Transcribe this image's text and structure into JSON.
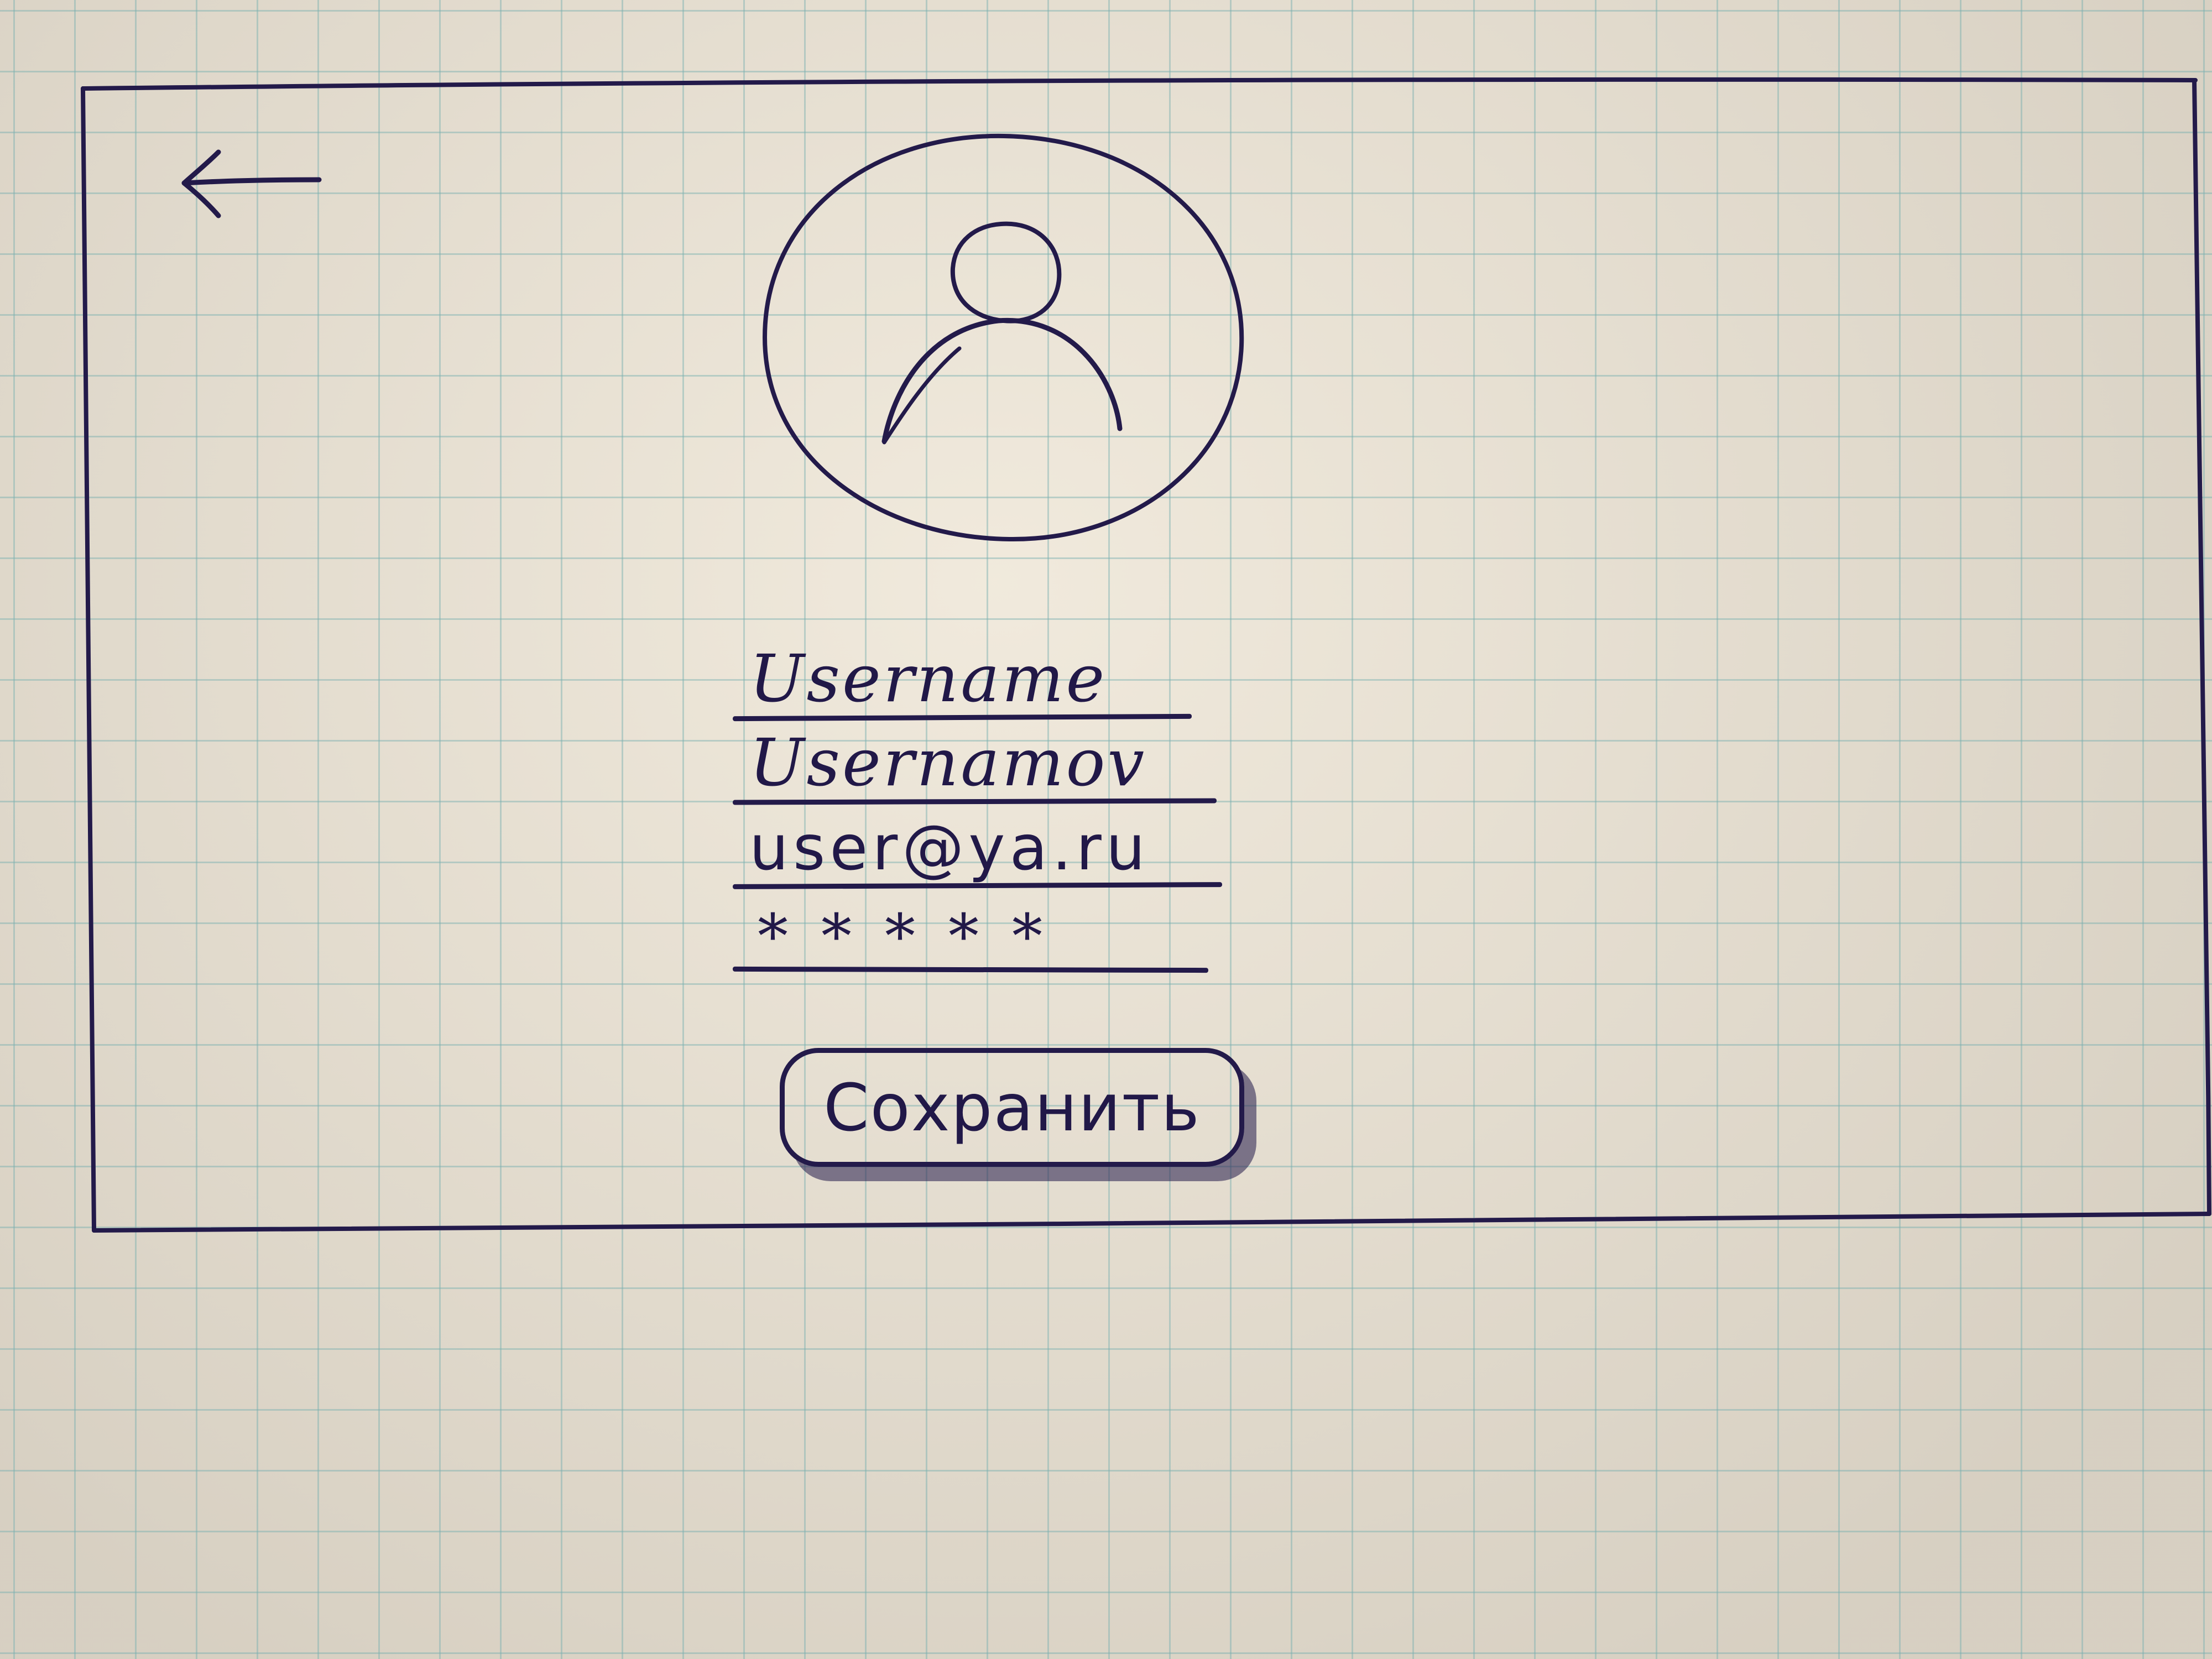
{
  "screen": {
    "kind": "hand-drawn profile edit wireframe",
    "ink_color": "#231a4a",
    "paper_color": "#e9e1d2",
    "grid_color": "#78afaf"
  },
  "header": {
    "back_icon": "left-arrow-icon"
  },
  "avatar": {
    "icon": "user-silhouette-icon"
  },
  "form": {
    "fields": [
      {
        "name": "username",
        "value": "Username"
      },
      {
        "name": "lastname",
        "value": "Usernamov"
      },
      {
        "name": "email",
        "value": "user@ya.ru"
      },
      {
        "name": "password",
        "value": "*****"
      }
    ]
  },
  "actions": {
    "save_label": "Сохранить"
  }
}
